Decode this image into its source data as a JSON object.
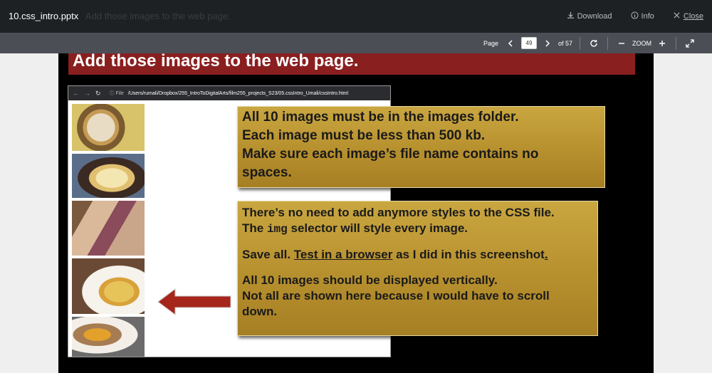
{
  "header": {
    "filename": "10.css_intro.pptx",
    "ghost_title": "Add those images to the web page.",
    "download_label": "Download",
    "info_label": "Info",
    "close_label": "Close"
  },
  "toolbar": {
    "page_label": "Page",
    "current_page": "49",
    "of_label": "of 57",
    "zoom_label": "ZOOM"
  },
  "slide": {
    "title": "Add those images to the web page.",
    "browser": {
      "file_label": "File",
      "url": "/Users/rumali/Dropbox/255_IntroToDigitalArts/film255_projects_S23/05.cssIntro_Umali/cssIntro.html"
    },
    "callout1": {
      "line1": "All 10 images must be in the images folder.",
      "line2": "Each image must be less than 500 kb.",
      "line3": "Make sure each image’s file name contains no",
      "line4": "spaces."
    },
    "callout2": {
      "line1": "There’s no need to add anymore styles to the CSS file.",
      "line2_pre": "The ",
      "line2_code": "img",
      "line2_post": " selector will style every image.",
      "line3_pre": "Save all. ",
      "line3_link": "Test in a browser",
      "line3_post": " as I did in this screenshot",
      "line3_end": ".",
      "line4": "All 10 images should be displayed vertically.",
      "line5": "Not all are shown here because I would have to scroll",
      "line6": "down."
    }
  },
  "colors": {
    "title_bar": "#8a1f1f",
    "callout_gold": "#b7902e",
    "arrow_red": "#a6261c"
  }
}
